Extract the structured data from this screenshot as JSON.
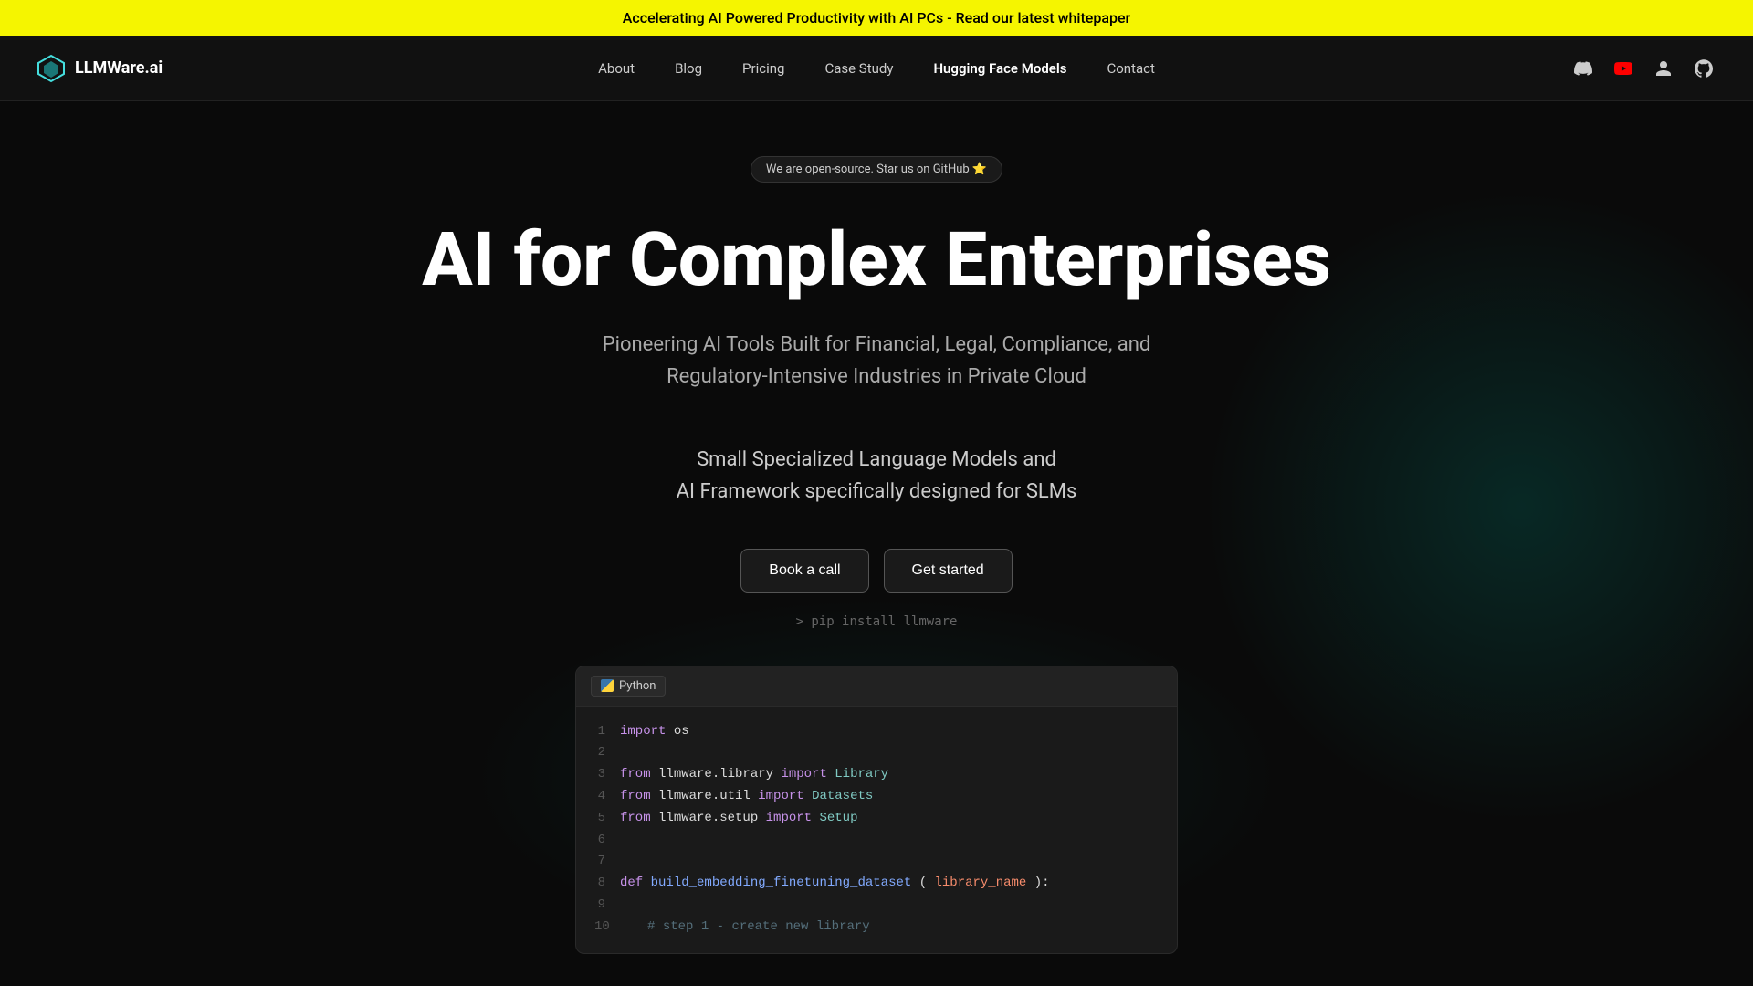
{
  "banner": {
    "text": "Accelerating AI Powered Productivity with AI PCs - Read our latest whitepaper"
  },
  "navbar": {
    "logo_text": "LLMWare.ai",
    "links": [
      {
        "label": "About",
        "bold": false
      },
      {
        "label": "Blog",
        "bold": false
      },
      {
        "label": "Pricing",
        "bold": false
      },
      {
        "label": "Case Study",
        "bold": false
      },
      {
        "label": "Hugging Face Models",
        "bold": true
      },
      {
        "label": "Contact",
        "bold": false
      }
    ],
    "icons": [
      "discord-icon",
      "youtube-icon",
      "user-icon",
      "github-icon"
    ]
  },
  "hero": {
    "github_badge": "We are open-source. Star us on GitHub ⭐",
    "title": "AI for Complex Enterprises",
    "subtitle": "Pioneering AI Tools Built for Financial, Legal, Compliance, and Regulatory-Intensive Industries in Private Cloud",
    "tagline1": "Small Specialized Language Models and",
    "tagline2": "AI Framework specifically designed for SLMs",
    "btn_book_call": "Book a call",
    "btn_get_started": "Get started",
    "pip_install": "> pip install llmware"
  },
  "code_block": {
    "language_label": "Python",
    "lines": [
      {
        "num": "1",
        "content": "import os"
      },
      {
        "num": "2",
        "content": ""
      },
      {
        "num": "3",
        "content": "from llmware.library import Library"
      },
      {
        "num": "4",
        "content": "from llmware.util import Datasets"
      },
      {
        "num": "5",
        "content": "from llmware.setup import Setup"
      },
      {
        "num": "6",
        "content": ""
      },
      {
        "num": "7",
        "content": ""
      },
      {
        "num": "8",
        "content": "def build_embedding_finetuning_dataset(library_name):"
      },
      {
        "num": "9",
        "content": ""
      },
      {
        "num": "10",
        "content": "  # step 1 - create new library"
      }
    ]
  }
}
